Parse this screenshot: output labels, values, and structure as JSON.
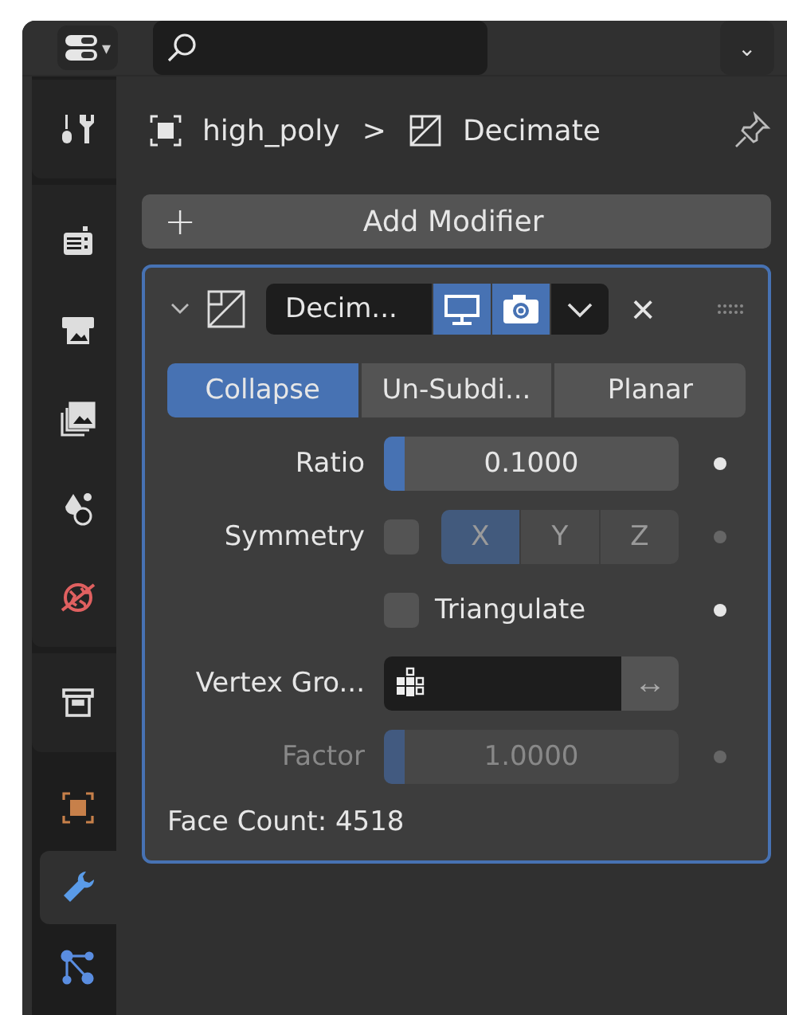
{
  "header": {
    "editor_menu": "▾",
    "dropdown": "⌄"
  },
  "sidebar": {
    "groups": [
      {
        "tabs": [
          {
            "kind": "tool",
            "selected": false
          }
        ]
      },
      {
        "tabs": [
          {
            "kind": "render",
            "selected": false
          },
          {
            "kind": "output",
            "selected": false
          },
          {
            "kind": "view_layer",
            "selected": false
          },
          {
            "kind": "scene",
            "selected": false
          },
          {
            "kind": "world",
            "selected": false
          }
        ]
      },
      {
        "tabs": [
          {
            "kind": "collection",
            "selected": false
          }
        ]
      },
      {
        "tabs": [
          {
            "kind": "object",
            "selected": false
          },
          {
            "kind": "modifier",
            "selected": true
          },
          {
            "kind": "data",
            "selected": false
          }
        ]
      }
    ]
  },
  "breadcrumb": {
    "object": "high_poly",
    "separator": ">",
    "modifier": "Decimate"
  },
  "add_modifier": {
    "plus": "+",
    "label": "Add Modifier"
  },
  "modifier": {
    "expanded": true,
    "name": "Decim...",
    "show_viewport": true,
    "show_render": true,
    "close": "×",
    "modes": [
      {
        "label": "Collapse",
        "selected": true
      },
      {
        "label": "Un-Subdi...",
        "selected": false
      },
      {
        "label": "Planar",
        "selected": false
      }
    ],
    "ratio": {
      "label": "Ratio",
      "value": "0.1000",
      "level": 0.07
    },
    "symmetry": {
      "label": "Symmetry",
      "checked": false,
      "axes": [
        {
          "label": "X",
          "selected": true
        },
        {
          "label": "Y",
          "selected": false
        },
        {
          "label": "Z",
          "selected": false
        }
      ]
    },
    "triangulate": {
      "label": "Triangulate",
      "checked": false
    },
    "vertex_group": {
      "label": "Vertex Gro...",
      "invert": "↔"
    },
    "factor": {
      "label": "Factor",
      "value": "1.0000",
      "level": 0.07,
      "disabled": true
    },
    "face_count": "Face Count: 4518"
  }
}
